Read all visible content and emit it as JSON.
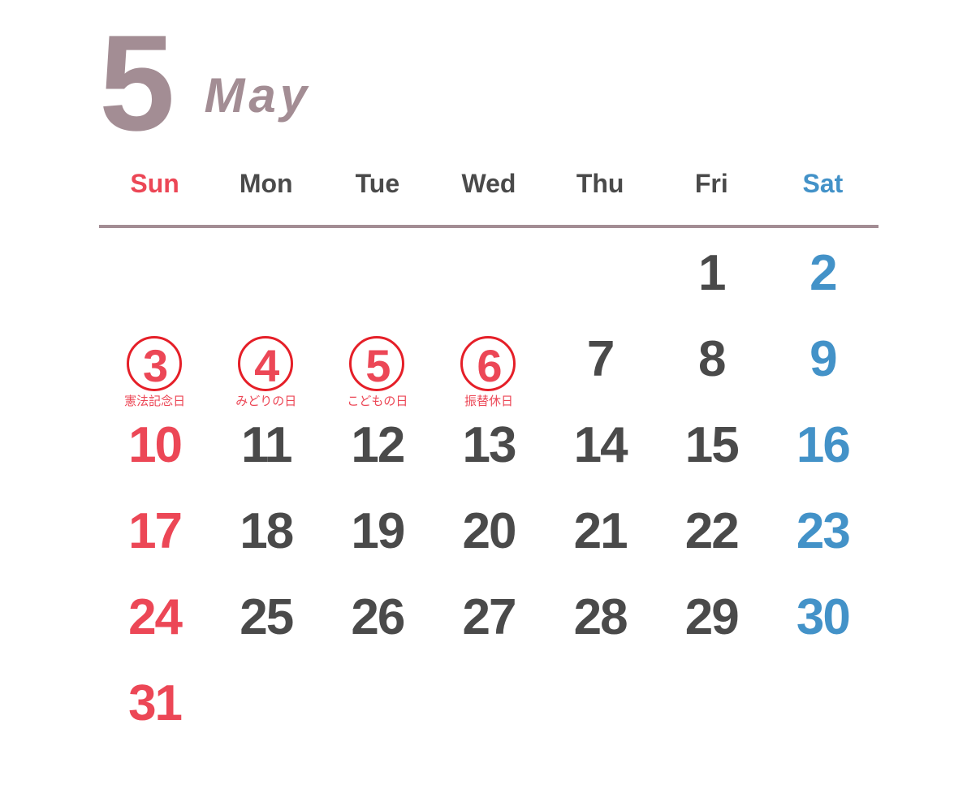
{
  "header": {
    "month_number": "5",
    "month_name": "May"
  },
  "weekdays": [
    {
      "label": "Sun",
      "kind": "sun"
    },
    {
      "label": "Mon",
      "kind": "weekday"
    },
    {
      "label": "Tue",
      "kind": "weekday"
    },
    {
      "label": "Wed",
      "kind": "weekday"
    },
    {
      "label": "Thu",
      "kind": "weekday"
    },
    {
      "label": "Fri",
      "kind": "weekday"
    },
    {
      "label": "Sat",
      "kind": "sat"
    }
  ],
  "colors": {
    "sunday_red": "#ec4756",
    "saturday_blue": "#4392c8",
    "weekday_gray": "#4a4a4a",
    "accent_mauve": "#a38d94",
    "circle_red": "#e51f28",
    "background": "#ffffff"
  },
  "weeks": [
    [
      {
        "day": "",
        "kind": "empty"
      },
      {
        "day": "",
        "kind": "empty"
      },
      {
        "day": "",
        "kind": "empty"
      },
      {
        "day": "",
        "kind": "empty"
      },
      {
        "day": "",
        "kind": "empty"
      },
      {
        "day": "1",
        "kind": "weekday"
      },
      {
        "day": "2",
        "kind": "sat"
      }
    ],
    [
      {
        "day": "3",
        "kind": "holiday",
        "circled": true,
        "holiday": "憲法記念日"
      },
      {
        "day": "4",
        "kind": "holiday",
        "circled": true,
        "holiday": "みどりの日"
      },
      {
        "day": "5",
        "kind": "holiday",
        "circled": true,
        "holiday": "こどもの日"
      },
      {
        "day": "6",
        "kind": "holiday",
        "circled": true,
        "holiday": "振替休日"
      },
      {
        "day": "7",
        "kind": "weekday"
      },
      {
        "day": "8",
        "kind": "weekday"
      },
      {
        "day": "9",
        "kind": "sat"
      }
    ],
    [
      {
        "day": "10",
        "kind": "sun"
      },
      {
        "day": "11",
        "kind": "weekday"
      },
      {
        "day": "12",
        "kind": "weekday"
      },
      {
        "day": "13",
        "kind": "weekday"
      },
      {
        "day": "14",
        "kind": "weekday"
      },
      {
        "day": "15",
        "kind": "weekday"
      },
      {
        "day": "16",
        "kind": "sat"
      }
    ],
    [
      {
        "day": "17",
        "kind": "sun"
      },
      {
        "day": "18",
        "kind": "weekday"
      },
      {
        "day": "19",
        "kind": "weekday"
      },
      {
        "day": "20",
        "kind": "weekday"
      },
      {
        "day": "21",
        "kind": "weekday"
      },
      {
        "day": "22",
        "kind": "weekday"
      },
      {
        "day": "23",
        "kind": "sat"
      }
    ],
    [
      {
        "day": "24",
        "kind": "sun"
      },
      {
        "day": "25",
        "kind": "weekday"
      },
      {
        "day": "26",
        "kind": "weekday"
      },
      {
        "day": "27",
        "kind": "weekday"
      },
      {
        "day": "28",
        "kind": "weekday"
      },
      {
        "day": "29",
        "kind": "weekday"
      },
      {
        "day": "30",
        "kind": "sat"
      }
    ],
    [
      {
        "day": "31",
        "kind": "sun"
      },
      {
        "day": "",
        "kind": "empty"
      },
      {
        "day": "",
        "kind": "empty"
      },
      {
        "day": "",
        "kind": "empty"
      },
      {
        "day": "",
        "kind": "empty"
      },
      {
        "day": "",
        "kind": "empty"
      },
      {
        "day": "",
        "kind": "empty"
      }
    ]
  ]
}
